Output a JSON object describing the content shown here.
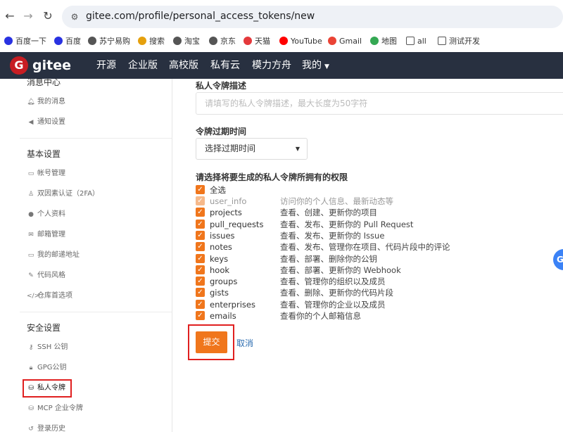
{
  "browser": {
    "url": "gitee.com/profile/personal_access_tokens/new",
    "bookmarks": [
      {
        "label": "百度一下",
        "icon": "baidu-icon",
        "color": "#2932e1"
      },
      {
        "label": "百度",
        "icon": "baidu-icon",
        "color": "#2932e1"
      },
      {
        "label": "苏宁易购",
        "icon": "globe-icon",
        "color": "#555555"
      },
      {
        "label": "搜索",
        "icon": "search-engine-icon",
        "color": "#e5a00d"
      },
      {
        "label": "淘宝",
        "icon": "globe-icon",
        "color": "#555555"
      },
      {
        "label": "京东",
        "icon": "globe-icon",
        "color": "#555555"
      },
      {
        "label": "天猫",
        "icon": "tmall-icon",
        "color": "#e4393c"
      },
      {
        "label": "YouTube",
        "icon": "youtube-icon",
        "color": "#ff0000"
      },
      {
        "label": "Gmail",
        "icon": "gmail-icon",
        "color": "#ea4335"
      },
      {
        "label": "地图",
        "icon": "maps-icon",
        "color": "#34a853"
      },
      {
        "label": "all",
        "icon": "folder-icon",
        "color": "#555555"
      },
      {
        "label": "测试开发",
        "icon": "folder-icon",
        "color": "#555555"
      }
    ]
  },
  "header": {
    "logo": "gitee",
    "logo_mark": "G",
    "nav": [
      "开源",
      "企业版",
      "高校版",
      "私有云",
      "模力方舟",
      "我的"
    ]
  },
  "sidebar": {
    "sections": [
      {
        "title": "消息中心",
        "items": [
          {
            "label": "我的消息",
            "icon": "bell-icon"
          },
          {
            "label": "通知设置",
            "icon": "speaker-icon"
          }
        ]
      },
      {
        "title": "基本设置",
        "items": [
          {
            "label": "帐号管理",
            "icon": "id-card-icon"
          },
          {
            "label": "双因素认证（2FA）",
            "icon": "user-key-icon"
          },
          {
            "label": "个人资料",
            "icon": "user-icon"
          },
          {
            "label": "邮箱管理",
            "icon": "envelope-icon"
          },
          {
            "label": "我的邮递地址",
            "icon": "address-icon"
          },
          {
            "label": "代码风格",
            "icon": "brush-icon"
          },
          {
            "label": "仓库首选项",
            "icon": "code-icon"
          }
        ]
      },
      {
        "title": "安全设置",
        "items": [
          {
            "label": "SSH 公钥",
            "icon": "key-icon"
          },
          {
            "label": "GPG公钥",
            "icon": "lock-icon"
          },
          {
            "label": "私人令牌",
            "icon": "token-icon"
          },
          {
            "label": "MCP 企业令牌",
            "icon": "token-icon"
          },
          {
            "label": "登录历史",
            "icon": "history-icon"
          }
        ]
      }
    ],
    "active_item": "私人令牌"
  },
  "form": {
    "desc_label": "私人令牌描述",
    "desc_placeholder": "请填写的私人令牌描述，最大长度为50字符",
    "expire_label": "令牌过期时间",
    "expire_select": "选择过期时间",
    "perm_label": "请选择将要生成的私人令牌所拥有的权限",
    "select_all": "全选",
    "permissions": [
      {
        "name": "user_info",
        "desc": "访问你的个人信息、最新动态等",
        "disabled": true
      },
      {
        "name": "projects",
        "desc": "查看、创建、更新你的项目",
        "disabled": false
      },
      {
        "name": "pull_requests",
        "desc": "查看、发布、更新你的 Pull Request",
        "disabled": false
      },
      {
        "name": "issues",
        "desc": "查看、发布、更新你的 Issue",
        "disabled": false
      },
      {
        "name": "notes",
        "desc": "查看、发布、管理你在项目、代码片段中的评论",
        "disabled": false
      },
      {
        "name": "keys",
        "desc": "查看、部署、删除你的公钥",
        "disabled": false
      },
      {
        "name": "hook",
        "desc": "查看、部署、更新你的 Webhook",
        "disabled": false
      },
      {
        "name": "groups",
        "desc": "查看、管理你的组织以及成员",
        "disabled": false
      },
      {
        "name": "gists",
        "desc": "查看、删除、更新你的代码片段",
        "disabled": false
      },
      {
        "name": "enterprises",
        "desc": "查看、管理你的企业以及成员",
        "disabled": false
      },
      {
        "name": "emails",
        "desc": "查看你的个人邮箱信息",
        "disabled": false
      }
    ],
    "submit": "提交",
    "cancel": "取消"
  },
  "float_button": "G",
  "colors": {
    "accent": "#f0761c",
    "header_bg": "#283040",
    "highlight_border": "#e02020",
    "link": "#2b6cb0"
  }
}
